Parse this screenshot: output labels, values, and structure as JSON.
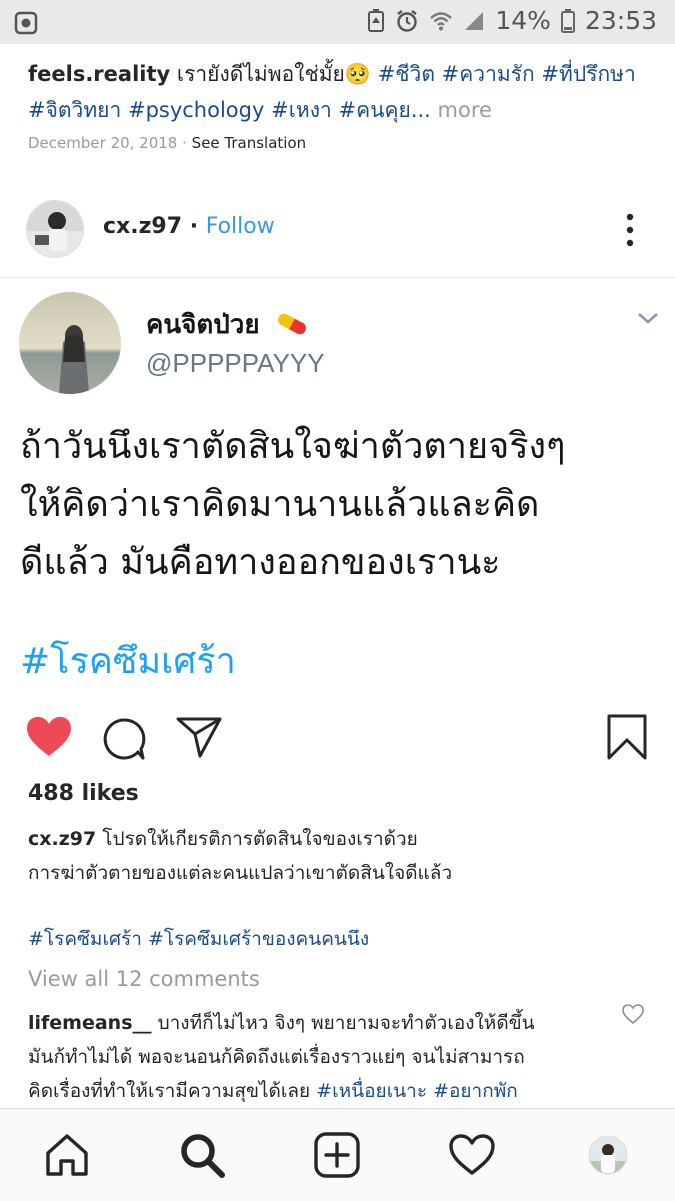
{
  "status_bar": {
    "battery_percent": "14%",
    "time": "23:53"
  },
  "prev_post": {
    "username": "feels.reality",
    "caption": "เรายังดีไม่พอใช่มั้ย🥺",
    "tags_line1": [
      "#ชีวิต",
      "#ความรัก",
      "#ที่ปรึกษา"
    ],
    "tags_line2": [
      "#จิตวิทยา",
      "#psychology",
      "#เหงา",
      "#คนคุย..."
    ],
    "more": "more",
    "date": "December 20, 2018",
    "see_translation": "See Translation"
  },
  "post": {
    "username": "cx.z97",
    "follow": "Follow",
    "tweet": {
      "name": "คนจิตป่วย",
      "handle": "@PPPPPAYYY",
      "text_line1": "ถ้าวันนึงเราตัดสินใจฆ่าตัวตายจริงๆ",
      "text_line2": "ให้คิดว่าเราคิดมานานแล้วและคิด",
      "text_line3": "ดีแล้ว มันคือทางออกของเรานะ",
      "hashtag": "#โรคซึมเศร้า"
    },
    "likes": "488 likes",
    "caption_user": "cx.z97",
    "caption_line1": "โปรดให้เกียรติการตัดสินใจของเราด้วย",
    "caption_line2": "การฆ่าตัวตายของแต่ละคนแปลว่าเขาตัดสินใจดีแล้ว",
    "tags": [
      "#โรคซึมเศร้า",
      "#โรคซึมเศร้าของคนคนนึง"
    ],
    "view_all": "View all 12 comments",
    "comment": {
      "user": "lifemeans__",
      "line1": "บางทีก็ไม่ไหว จิงๆ พยายามจะทำตัวเองให้ดีขึ้น",
      "line2": "มันก้ทำไม่ได้ พอจะนอนก้คิดถึงแต่เรื่องราวแย่ๆ จนไม่สามารถ",
      "line3": "คิดเรื่องที่ทำให้เรามีความสุขได้เลย",
      "tags": [
        "#เหนื่อยเนาะ",
        "#อยากพัก"
      ]
    }
  },
  "colors": {
    "accent_blue": "#3897f0",
    "tag_blue": "#1a4c8c",
    "twitter_blue": "#1da1f2",
    "like_red": "#ed4956"
  },
  "icons": [
    "home-icon",
    "search-icon",
    "add-post-icon",
    "activity-heart-icon",
    "profile-avatar",
    "like-heart-icon",
    "comment-icon",
    "share-icon",
    "bookmark-icon"
  ]
}
